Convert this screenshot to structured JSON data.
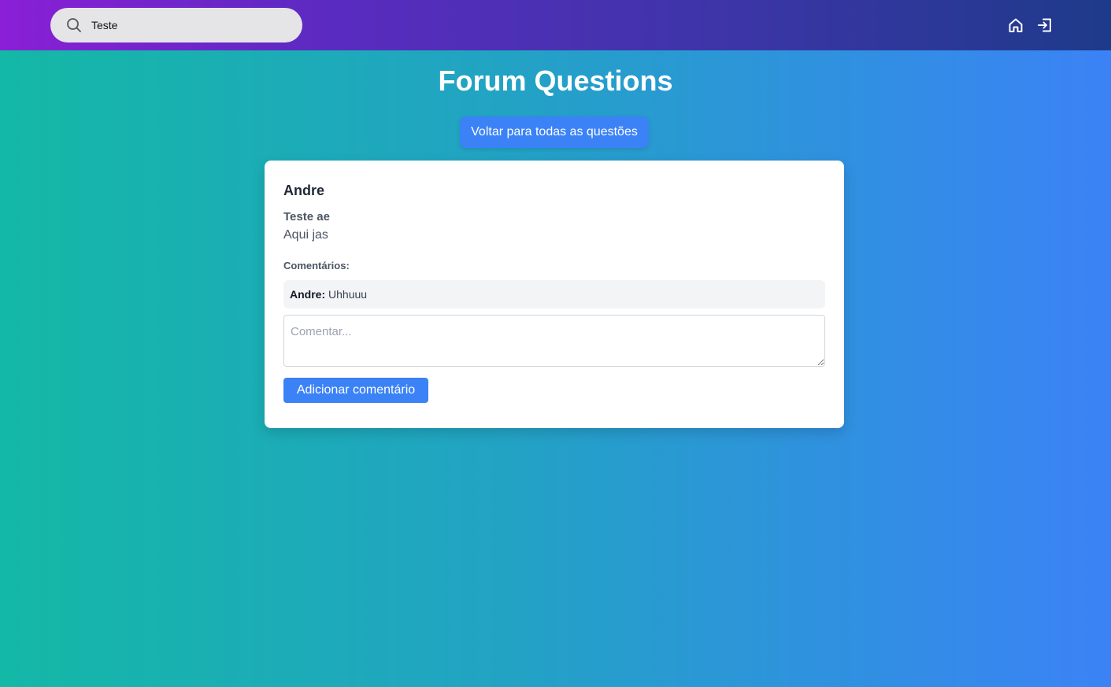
{
  "header": {
    "search": {
      "value": "Teste",
      "icon": "search-icon"
    },
    "icons": [
      "home-icon",
      "login-icon"
    ]
  },
  "page": {
    "title": "Forum Questions",
    "back_button_label": "Voltar para todas as questões"
  },
  "question": {
    "author": "Andre",
    "title": "Teste ae",
    "body": "Aqui jas",
    "comments_heading": "Comentários:",
    "comments": [
      {
        "author": "Andre:",
        "text": "Uhhuuu"
      }
    ],
    "comment_placeholder": "Comentar...",
    "add_comment_label": "Adicionar comentário"
  },
  "colors": {
    "accent": "#3b82f6",
    "topbar_start": "#8a1fd6",
    "topbar_end": "#1e3a8a",
    "bg_start": "#14b8a6",
    "bg_end": "#3b82f6"
  }
}
